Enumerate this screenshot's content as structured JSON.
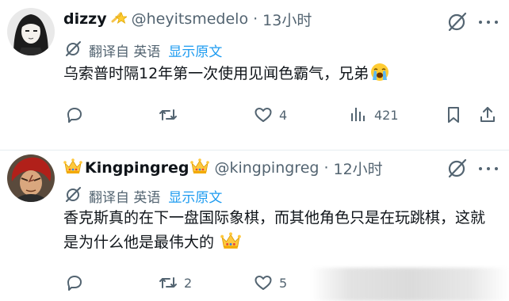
{
  "tweets": [
    {
      "name": "dizzy",
      "name_badge": "star-emoji",
      "handle": "@heyitsmedelo",
      "separator": "·",
      "time": "13小时",
      "translated_from": "翻译自 英语",
      "show_original": "显示原文",
      "text": "乌索普时隔12年第一次使用见闻色霸气，兄弟",
      "text_emoji": "crying-emoji",
      "actions": {
        "reply": "",
        "retweet": "",
        "like": "4",
        "views": "421"
      }
    },
    {
      "name": "Kingpingreg",
      "name_badge": "crown-emoji",
      "handle": "@kingpingreg",
      "separator": "·",
      "time": "12小时",
      "translated_from": "翻译自 英语",
      "show_original": "显示原文",
      "text": "香克斯真的在下一盘国际象棋，而其他角色只是在玩跳棋，这就是为什么他是最伟大的",
      "text_emoji": "crown-emoji",
      "actions": {
        "reply": "",
        "retweet": "2",
        "like": "5"
      }
    }
  ],
  "colors": {
    "link": "#1d9bf0",
    "secondary": "#536471",
    "primary": "#0f1419"
  }
}
